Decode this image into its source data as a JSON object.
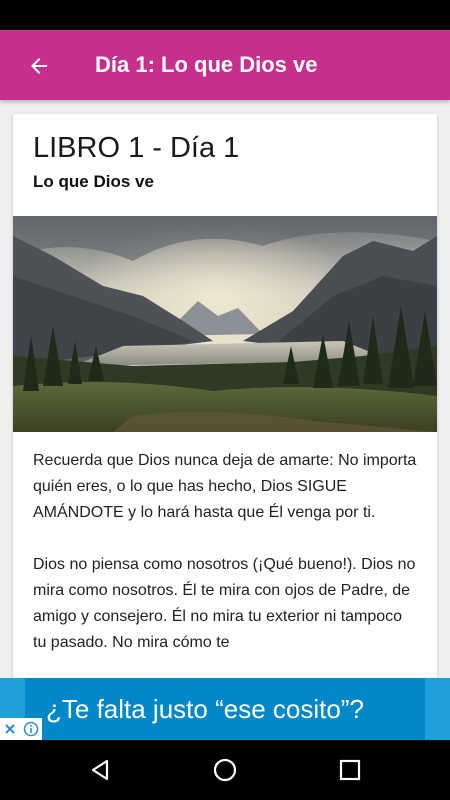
{
  "app_bar": {
    "title": "Día 1: Lo que Dios ve",
    "color": "#c72f8c",
    "back_icon": "arrow-left-icon"
  },
  "card": {
    "book_title": "LIBRO 1 - Día 1",
    "subtitle": "Lo que Dios ve",
    "image": "mountain-lake-landscape",
    "paragraphs": [
      "Recuerda que Dios nunca deja de amarte: No importa quién eres, o lo que has hecho, Dios SIGUE AMÁNDOTE y lo hará hasta que Él venga por ti.",
      "Dios no piensa como nosotros (¡Qué bueno!). Dios no mira como nosotros. Él te mira con ojos de Padre, de amigo y consejero. Él no mira tu exterior ni tampoco tu pasado. No mira cómo te"
    ]
  },
  "ad": {
    "text": "¿Te falta justo “ese cosito”?",
    "color": "#0288c9",
    "controls": [
      "close-icon",
      "info-icon"
    ]
  },
  "system_nav": {
    "buttons": [
      "back-triangle-icon",
      "home-circle-icon",
      "recents-square-icon"
    ]
  }
}
